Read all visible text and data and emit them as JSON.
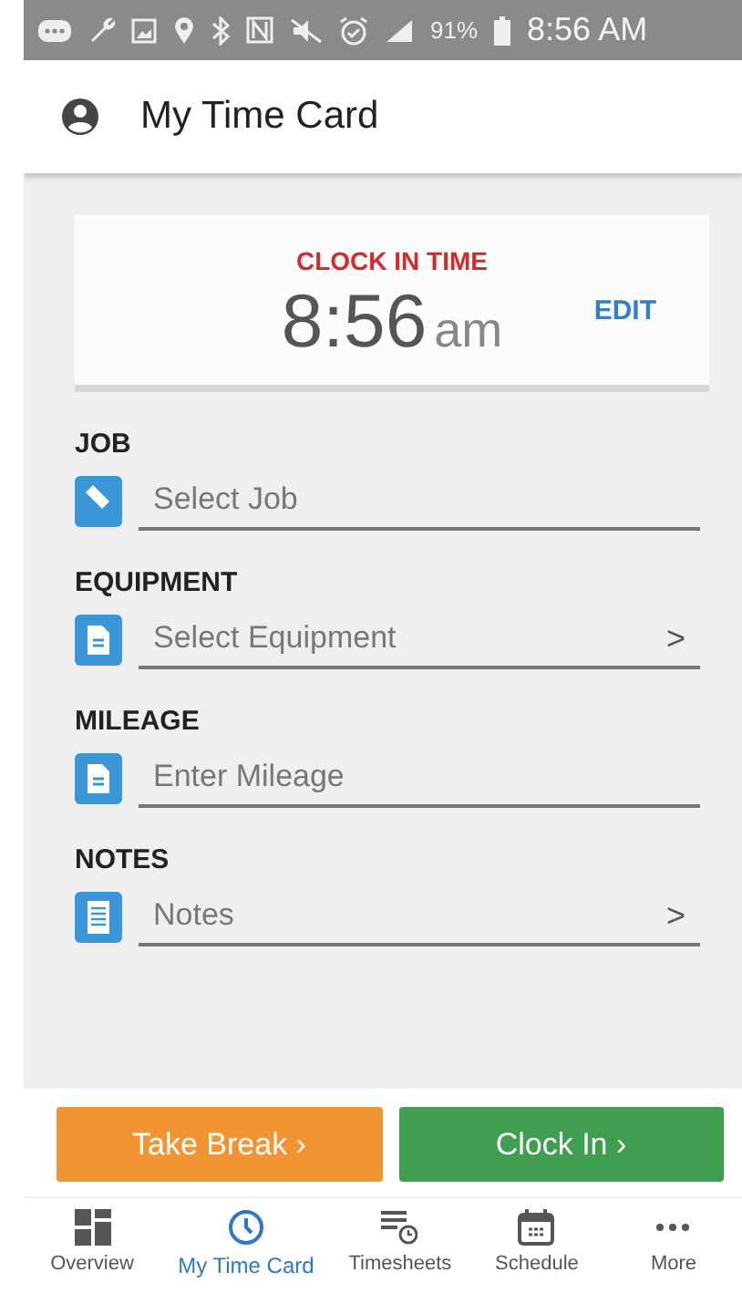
{
  "status_bar": {
    "battery": "91%",
    "time": "8:56 AM"
  },
  "app_bar": {
    "title": "My Time Card"
  },
  "clock_card": {
    "label": "CLOCK IN TIME",
    "time": "8:56",
    "period": "am",
    "action": "EDIT"
  },
  "fields": [
    {
      "label": "JOB",
      "kind": "input",
      "placeholder": "Select Job"
    },
    {
      "label": "EQUIPMENT",
      "kind": "select",
      "placeholder": "Select Equipment",
      "chevron": ">"
    },
    {
      "label": "MILEAGE",
      "kind": "input",
      "placeholder": "Enter Mileage"
    },
    {
      "label": "NOTES",
      "kind": "select",
      "placeholder": "Notes",
      "chevron": ">"
    }
  ],
  "buttons": [
    {
      "label": "Take Break ›",
      "kind": "break"
    },
    {
      "label": "Clock In ›",
      "kind": "clock_in"
    }
  ],
  "tabs": [
    {
      "label": "Overview",
      "selected": false
    },
    {
      "label": "My Time Card",
      "selected": true
    },
    {
      "label": "Timesheets",
      "selected": false
    },
    {
      "label": "Schedule",
      "selected": false
    },
    {
      "label": "More",
      "selected": false
    }
  ]
}
